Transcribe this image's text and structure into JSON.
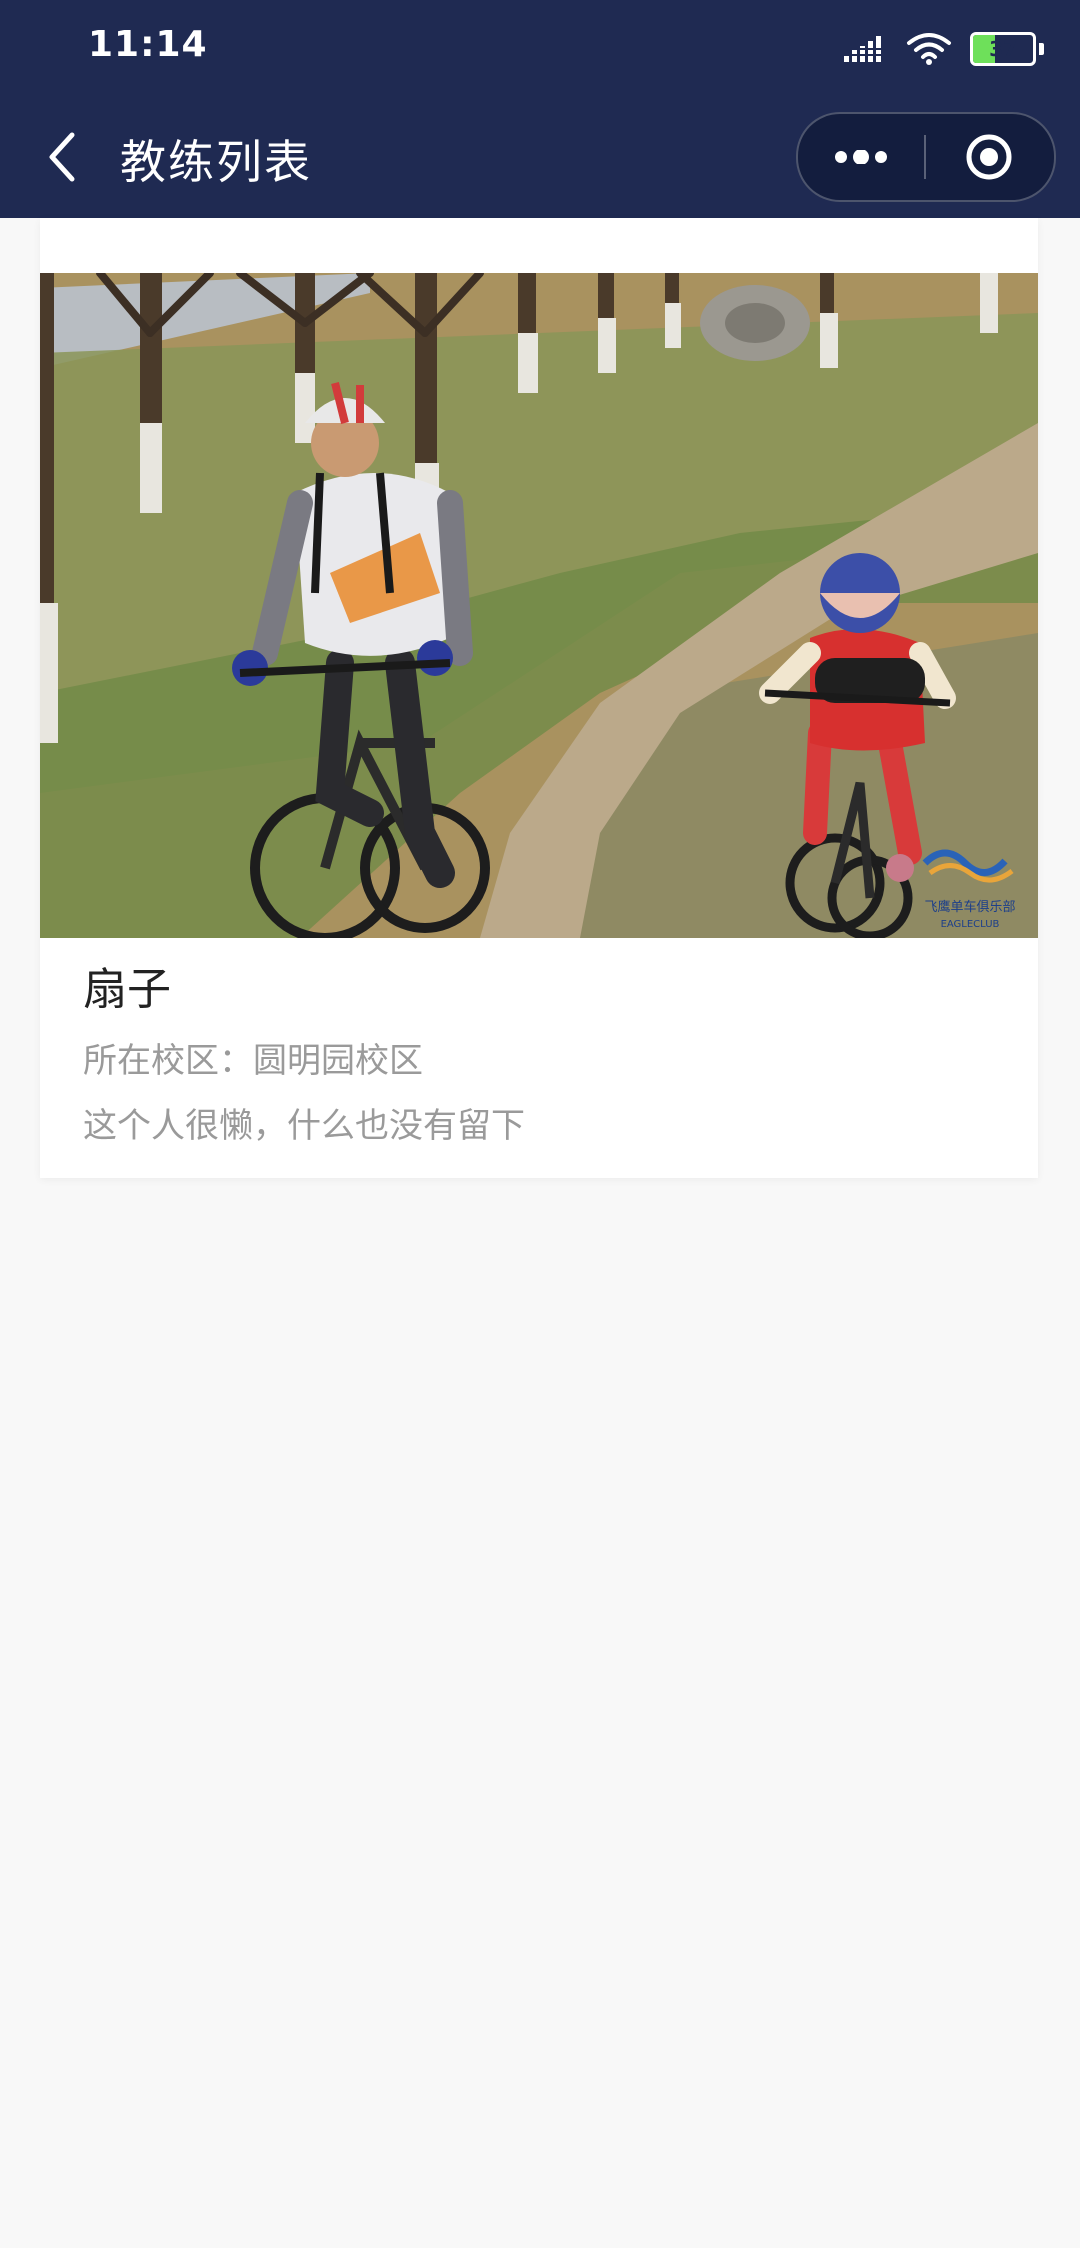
{
  "status_bar": {
    "time": "11:14",
    "battery_level": 37,
    "battery_label": "37",
    "icons": [
      "signal-icon",
      "wifi-icon",
      "battery-icon"
    ]
  },
  "nav": {
    "title": "教练列表",
    "back_icon": "chevron-left-icon",
    "capsule_more_icon": "more-dots-icon",
    "capsule_close_icon": "target-close-icon"
  },
  "coach": {
    "name": "扇子",
    "campus_label": "所在校区：",
    "campus_value": "圆明园校区",
    "bio": "这个人很懒，什么也没有留下",
    "photo_icon": "coach-photo",
    "photo_watermark": "飞鹰单车俱乐部",
    "photo_watermark_en": "EAGLECLUB"
  },
  "colors": {
    "header_bg": "#1f2a52",
    "page_bg": "#f8f8f8",
    "card_bg": "#ffffff",
    "muted_text": "#9a9a9a",
    "battery_fill": "#6ee05a"
  }
}
